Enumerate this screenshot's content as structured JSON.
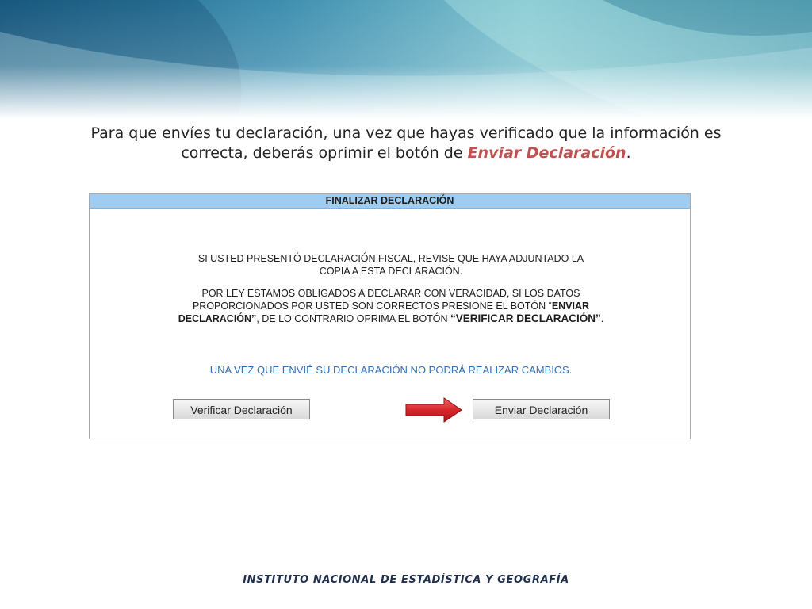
{
  "intro": {
    "line1": "Para que envíes tu declaración, una vez que hayas verificado que la información es",
    "line2_prefix": "correcta, deberás oprimir el botón de ",
    "line2_emphasis": "Enviar Declaración",
    "line2_suffix": "."
  },
  "dialog": {
    "title": "FINALIZAR DECLARACIÓN",
    "paragraph1_line1": "SI USTED PRESENTÓ DECLARACIÓN FISCAL, REVISE QUE HAYA ADJUNTADO LA",
    "paragraph1_line2": "COPIA A ESTA DECLARACIÓN.",
    "paragraph2_part1": "POR LEY ESTAMOS OBLIGADOS A DECLARAR CON VERACIDAD, SI LOS DATOS PROPORCIONADOS POR USTED SON CORRECTOS PRESIONE EL BOTÓN “",
    "paragraph2_bold1": "ENVIAR DECLARACIÓN”",
    "paragraph2_part2": ", DE LO CONTRARIO OPRIMA EL BOTÓN ",
    "paragraph2_bold2": "“VERIFICAR DECLARACIÓN”",
    "paragraph2_part3": ".",
    "notice": "UNA VEZ QUE ENVIÉ SU DECLARACIÓN NO PODRÁ REALIZAR CAMBIOS.",
    "verify_button": "Verificar Declaración",
    "send_button": "Enviar Declaración"
  },
  "footer": {
    "institution": "INSTITUTO NACIONAL  DE ESTADÍSTICA Y GEOGRAFÍA"
  },
  "icons": {
    "pointer": "right-arrow-icon"
  },
  "colors": {
    "header_bg": "#9fcdf2",
    "emphasis": "#c0504d",
    "notice": "#2f6fb5",
    "arrow": "#d8262a"
  }
}
